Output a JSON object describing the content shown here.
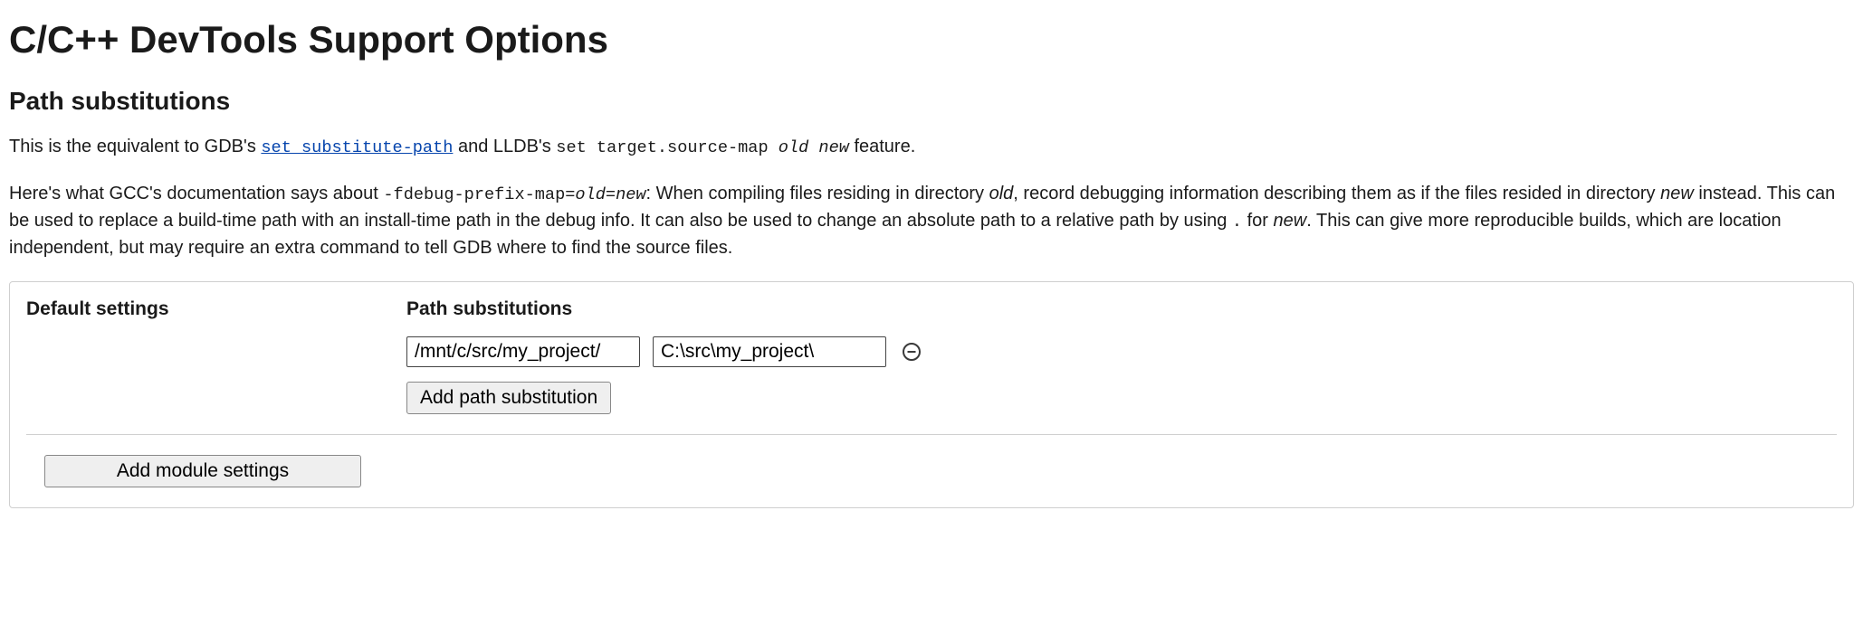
{
  "page_title": "C/C++ DevTools Support Options",
  "section_title": "Path substitutions",
  "para1": {
    "t0": "This is the equivalent to GDB's ",
    "link_text": "set substitute-path",
    "t1": " and LLDB's ",
    "code1": "set target.source-map ",
    "ital1": "old new",
    "t2": " feature."
  },
  "para2": {
    "t0": "Here's what GCC's documentation says about ",
    "code0": "-fdebug-prefix-map=",
    "ital0": "old",
    "eq": "=",
    "ital1": "new",
    "t1": ": When compiling files residing in directory ",
    "ital2": "old",
    "t2": ", record debugging information describing them as if the files resided in directory ",
    "ital3": "new",
    "t3": " instead. This can be used to replace a build-time path with an install-time path in the debug info. It can also be used to change an absolute path to a relative path by using ",
    "code1": ".",
    "t4": " for ",
    "ital4": "new",
    "t5": ". This can give more reproducible builds, which are location independent, but may require an extra command to tell GDB where to find the source files."
  },
  "panel": {
    "default_settings_label": "Default settings",
    "path_subst_label": "Path substitutions",
    "substitutions": [
      {
        "from": "/mnt/c/src/my_project/",
        "to": "C:\\src\\my_project\\"
      }
    ],
    "add_path_button": "Add path substitution",
    "add_module_button": "Add module settings"
  }
}
